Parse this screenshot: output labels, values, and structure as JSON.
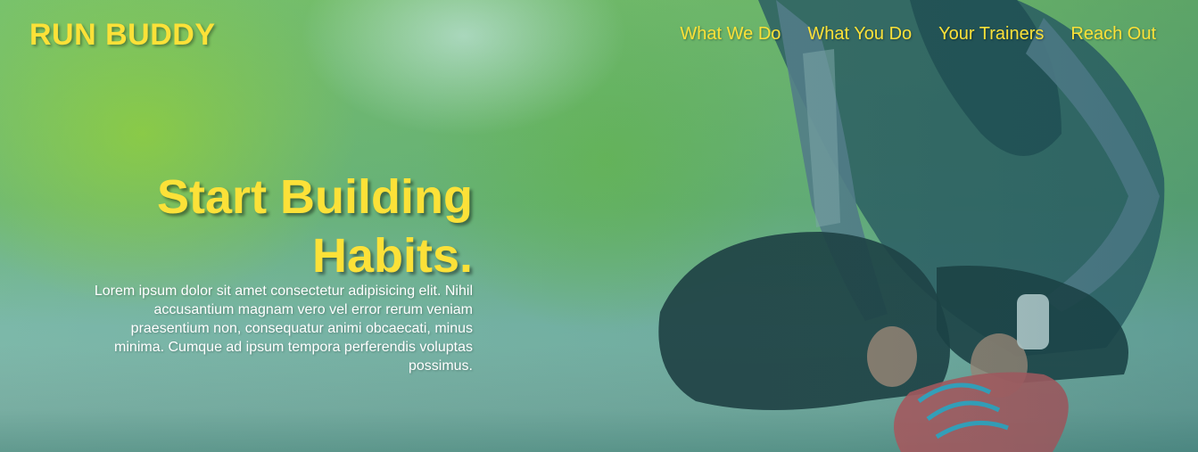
{
  "header": {
    "logo": "RUN BUDDY",
    "nav": [
      {
        "label": "What We Do"
      },
      {
        "label": "What You Do"
      },
      {
        "label": "Your Trainers"
      },
      {
        "label": "Reach Out"
      }
    ]
  },
  "hero": {
    "title": "Start Building Habits.",
    "body": "Lorem ipsum dolor sit amet consectetur adipisicing elit. Nihil accusantium magnam vero vel error rerum veniam praesentium non, consequatur animi obcaecati, minus minima. Cumque ad ipsum tempora perferendis voluptas possimus."
  },
  "colors": {
    "accent": "#fce138",
    "text": "#ffffff"
  }
}
